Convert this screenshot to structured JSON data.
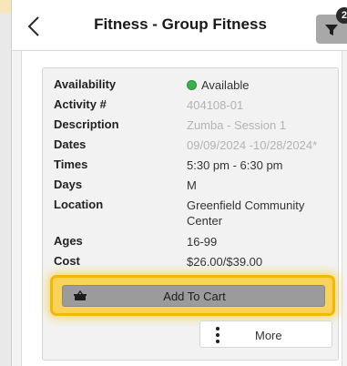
{
  "header": {
    "title": "Fitness - Group Fitness",
    "back_icon": "chevron-left-icon",
    "refresh_icon": "refresh-icon"
  },
  "filter": {
    "icon": "funnel-icon",
    "badge_count": "2"
  },
  "details": {
    "availability": {
      "label": "Availability",
      "value": "Available",
      "status_color": "#3cb04a"
    },
    "activity_number": {
      "label": "Activity #",
      "value": "404108-01"
    },
    "description": {
      "label": "Description",
      "value": "Zumba - Session 1"
    },
    "dates": {
      "label": "Dates",
      "value": "09/09/2024 -10/28/2024*"
    },
    "times": {
      "label": "Times",
      "value": "5:30 pm - 6:30 pm"
    },
    "days": {
      "label": "Days",
      "value": "M"
    },
    "location": {
      "label": "Location",
      "value": "Greenfield Community Center"
    },
    "ages": {
      "label": "Ages",
      "value": "16-99"
    },
    "cost": {
      "label": "Cost",
      "value": "$26.00/$39.00"
    }
  },
  "actions": {
    "add_to_cart_label": "Add To Cart",
    "cart_icon": "shopping-basket-icon",
    "more_label": "More",
    "more_icon": "vertical-ellipsis-icon"
  },
  "colors": {
    "highlight": "#f5b800",
    "muted_text": "#b3b3b3",
    "button_gray": "#9b9b9b"
  }
}
